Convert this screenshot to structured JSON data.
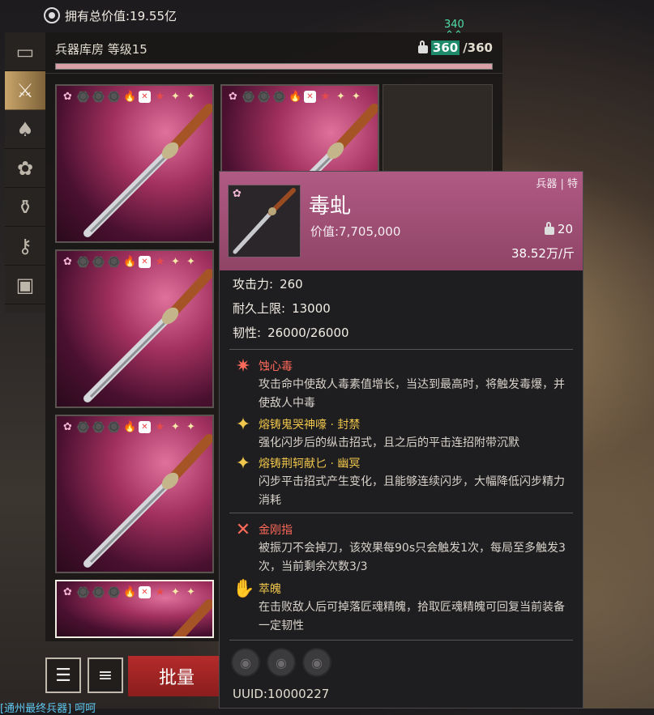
{
  "header": {
    "total_value_label": "拥有总价值:19.55亿",
    "eye_icon": "eye-icon"
  },
  "nav": {
    "items": [
      {
        "name": "chest-icon",
        "glyph": "▭"
      },
      {
        "name": "crossed-swords-icon",
        "glyph": "⚔",
        "active": true
      },
      {
        "name": "armor-icon",
        "glyph": "♠"
      },
      {
        "name": "ornament-icon",
        "glyph": "✿"
      },
      {
        "name": "vase-icon",
        "glyph": "⚱"
      },
      {
        "name": "key-icon",
        "glyph": "⚷"
      },
      {
        "name": "anvil-icon",
        "glyph": "▣"
      }
    ]
  },
  "armory": {
    "title": "兵器库房 等级15",
    "capacity_current": "360",
    "capacity_sep_max": "/360",
    "upgrade_note": "340",
    "upgrade_arrow": "⌃⌃",
    "fill_fraction": 1.0
  },
  "weapons": [
    {
      "selected": false
    },
    {
      "selected": false
    },
    {
      "selected": false
    },
    {
      "selected": false
    },
    {
      "selected": true
    }
  ],
  "card_icons": [
    "✿",
    "⬡",
    "⬡",
    "⬡",
    "🔥",
    "✕",
    "★",
    "✦",
    "✦"
  ],
  "bottom": {
    "batch_label": "批量",
    "chat_text": "[通州最终兵器] 呵呵"
  },
  "tooltip": {
    "category": "兵器 | 特",
    "name": "毒虬",
    "value": "价值:7,705,000",
    "weight": "20",
    "unit_price": "38.52万/斤",
    "stats": [
      {
        "label": "攻击力:",
        "value": "260"
      },
      {
        "label": "耐久上限:",
        "value": "13000"
      },
      {
        "label": "韧性:",
        "value": "26000/26000"
      }
    ],
    "traits": [
      {
        "icon": "✷",
        "name": "蚀心毒",
        "color": "red",
        "desc": "攻击命中使敌人毒素值增长，当达到最高时，将触发毒爆，并使敌人中毒"
      },
      {
        "icon": "✦",
        "name": "熔铸鬼哭神嚎 · 封禁",
        "color": "gold",
        "desc": "强化闪步后的纵击招式，且之后的平击连招附带沉默"
      },
      {
        "icon": "✦",
        "name": "熔铸荆轲献匕 · 幽冥",
        "color": "gold",
        "desc": "闪步平击招式产生变化，且能够连续闪步，大幅降低闪步精力消耗"
      }
    ],
    "passives": [
      {
        "icon": "✕",
        "name": "金刚指",
        "color": "red",
        "desc": "被振刀不会掉刀，该效果每90s只会触发1次，每局至多触发3次，当前剩余次数3/3"
      },
      {
        "icon": "✋",
        "name": "萃魄",
        "color": "gold",
        "desc": "在击败敌人后可掉落匠魂精魄，拾取匠魂精魄可回复当前装备一定韧性"
      }
    ],
    "uuid": "UUID:10000227"
  },
  "colors": {
    "tooltip_head": "#a04f77",
    "trait_red": "#ff6a5a",
    "trait_gold": "#f0c64c",
    "capacity_highlight": "#1d8a6a",
    "batch_button": "#b52b2b"
  }
}
